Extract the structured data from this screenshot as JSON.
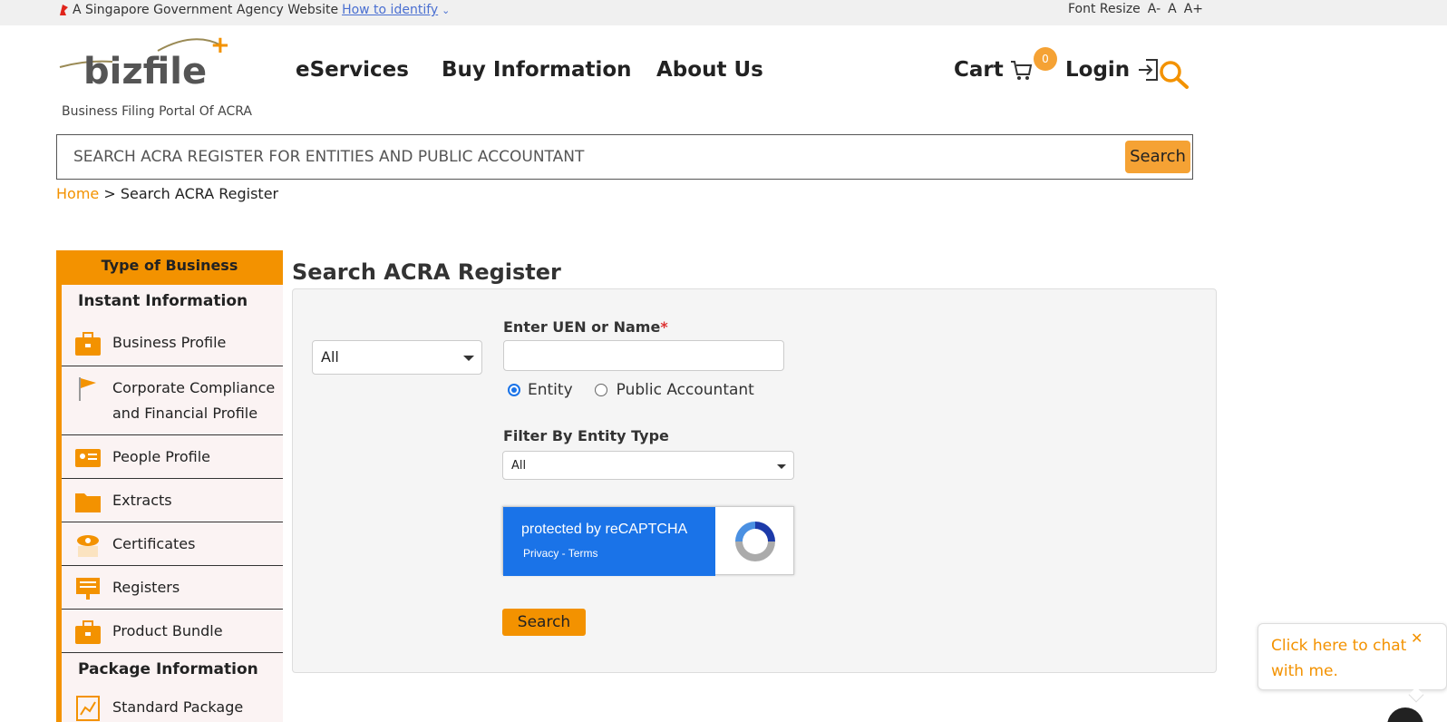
{
  "govbar": {
    "text": "A Singapore Government Agency Website",
    "link": "How to identify",
    "font_resize_label": "Font Resize",
    "font_options": [
      "A-",
      "A",
      "A+"
    ]
  },
  "header": {
    "logo_text": "bizfile",
    "tagline": "Business Filing Portal Of ACRA",
    "nav": [
      "eServices",
      "Buy Information",
      "About Us"
    ],
    "cart_label": "Cart",
    "cart_count": "0",
    "login_label": "Login"
  },
  "search": {
    "placeholder": "SEARCH ACRA REGISTER FOR ENTITIES AND PUBLIC ACCOUNTANT",
    "button": "Search"
  },
  "breadcrumb": {
    "home": "Home",
    "separator": ">",
    "current": "Search ACRA Register"
  },
  "sidebar": {
    "title": "Type of Business Information",
    "section1": "Instant Information",
    "items": [
      {
        "label": "Business Profile",
        "icon": "briefcase-icon"
      },
      {
        "label": "Corporate Compliance and Financial Profile",
        "icon": "flag-icon"
      },
      {
        "label": "People Profile",
        "icon": "id-card-icon"
      },
      {
        "label": "Extracts",
        "icon": "folder-icon"
      },
      {
        "label": "Certificates",
        "icon": "certificate-icon"
      },
      {
        "label": "Registers",
        "icon": "register-icon"
      },
      {
        "label": "Product Bundle",
        "icon": "briefcase-icon"
      }
    ],
    "section2": "Package Information",
    "package_items": [
      {
        "label": "Standard Package",
        "icon": "chart-icon"
      }
    ]
  },
  "main": {
    "title": "Search ACRA Register",
    "type_select": "All",
    "uen_label": "Enter UEN or Name",
    "required_mark": "*",
    "radio_entity": "Entity",
    "radio_accountant": "Public Accountant",
    "filter_label": "Filter By Entity Type",
    "filter_select": "All",
    "recaptcha_title": "protected by reCAPTCHA",
    "recaptcha_links": "Privacy - Terms",
    "search_button": "Search"
  },
  "chat": {
    "text": "Click here to chat with me.",
    "close": "✕"
  },
  "colors": {
    "accent": "#f39200",
    "button_orange": "#f5a234",
    "recaptcha_blue": "#1a73e8"
  }
}
